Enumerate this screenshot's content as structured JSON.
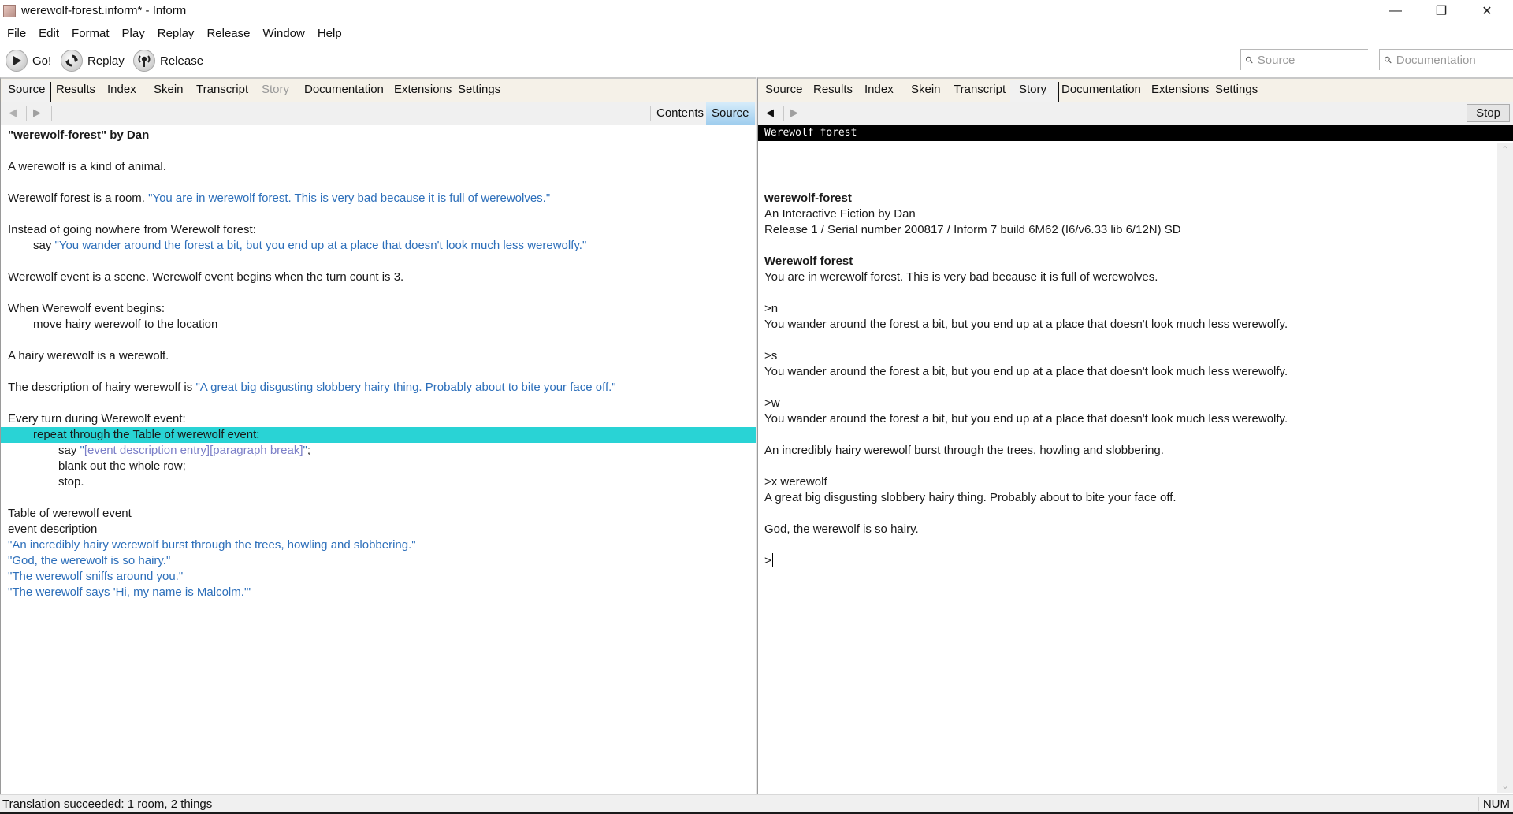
{
  "window": {
    "title": "werewolf-forest.inform* - Inform",
    "controls": {
      "minimize": "—",
      "maximize": "❐",
      "close": "✕"
    }
  },
  "menu": [
    "File",
    "Edit",
    "Format",
    "Play",
    "Replay",
    "Release",
    "Window",
    "Help"
  ],
  "toolbar": {
    "go": {
      "label": "Go!",
      "icon": "play-icon"
    },
    "replay": {
      "label": "Replay",
      "icon": "replay-icon"
    },
    "release": {
      "label": "Release",
      "icon": "release-icon"
    },
    "search_source_placeholder": "Source",
    "search_docs_placeholder": "Documentation"
  },
  "left_pane": {
    "tabs": [
      {
        "label": "Source",
        "selected": true,
        "dim": false
      },
      {
        "label": "Results",
        "dim": false
      },
      {
        "label": "Index",
        "dim": false
      },
      {
        "label": "Skein",
        "dim": false
      },
      {
        "label": "Transcript",
        "dim": false
      },
      {
        "label": "Story",
        "dim": true
      },
      {
        "label": "Documentation",
        "dim": false
      },
      {
        "label": "Extensions",
        "dim": false
      },
      {
        "label": "Settings",
        "dim": false
      }
    ],
    "nav": {
      "back": "◀",
      "forward": "▶",
      "contents_label": "Contents",
      "source_label": "Source"
    },
    "source_lines": [
      {
        "text": "\"werewolf-forest\" by Dan",
        "style": "bold"
      },
      {
        "text": ""
      },
      {
        "text": "A werewolf is a kind of animal."
      },
      {
        "text": ""
      },
      {
        "text": "Werewolf forest is a room. ",
        "quote": "\"You are in werewolf forest. This is very bad because it is full of werewolves.\""
      },
      {
        "text": ""
      },
      {
        "text": "Instead of going nowhere from Werewolf forest:"
      },
      {
        "text": "say ",
        "indent": 1,
        "quote": "\"You wander around the forest a bit, but you end up at a place that doesn't look much less werewolfy.\""
      },
      {
        "text": ""
      },
      {
        "text": "Werewolf event is a scene. Werewolf event begins when the turn count is 3."
      },
      {
        "text": ""
      },
      {
        "text": "When Werewolf event begins:"
      },
      {
        "text": "move hairy werewolf to the location",
        "indent": 1
      },
      {
        "text": ""
      },
      {
        "text": "A hairy werewolf is a werewolf."
      },
      {
        "text": ""
      },
      {
        "text": "The description of hairy werewolf is ",
        "quote": "\"A great big disgusting slobbery hairy thing. Probably about to bite your face off.\""
      },
      {
        "text": ""
      },
      {
        "text": "Every turn during Werewolf event:"
      },
      {
        "text": "repeat through the Table of werewolf event:",
        "indent": 1,
        "highlight": true
      },
      {
        "text": "say ",
        "indent": 2,
        "quote_open": "\"",
        "substitution": "[event description entry][paragraph break]",
        "quote_close": "\"",
        "tail": ";"
      },
      {
        "text": "blank out the whole row;",
        "indent": 2
      },
      {
        "text": "stop.",
        "indent": 2
      },
      {
        "text": ""
      },
      {
        "text": "Table of werewolf event"
      },
      {
        "text": "event description"
      },
      {
        "text": "",
        "quote": "\"An incredibly hairy werewolf burst through the trees, howling and slobbering.\""
      },
      {
        "text": "",
        "quote": "\"God, the werewolf is so hairy.\""
      },
      {
        "text": "",
        "quote": "\"The werewolf sniffs around you.\""
      },
      {
        "text": "",
        "quote": "\"The werewolf says 'Hi, my name is Malcolm.'\""
      }
    ]
  },
  "right_pane": {
    "tabs": [
      {
        "label": "Source",
        "dim": false
      },
      {
        "label": "Results",
        "dim": false
      },
      {
        "label": "Index",
        "dim": false
      },
      {
        "label": "Skein",
        "dim": false
      },
      {
        "label": "Transcript",
        "dim": false
      },
      {
        "label": "Story",
        "selected": true,
        "dim": false
      },
      {
        "label": "Documentation",
        "dim": false
      },
      {
        "label": "Extensions",
        "dim": false
      },
      {
        "label": "Settings",
        "dim": false
      }
    ],
    "nav": {
      "back": "◀",
      "forward": "▶",
      "stop_label": "Stop"
    },
    "status_line": "Werewolf forest",
    "story_lines": [
      {
        "text": "werewolf-forest",
        "style": "bold"
      },
      {
        "text": "An Interactive Fiction by Dan"
      },
      {
        "text": "Release 1 / Serial number 200817 / Inform 7 build 6M62 (I6/v6.33 lib 6/12N) SD"
      },
      {
        "text": ""
      },
      {
        "text": "Werewolf forest",
        "style": "bold"
      },
      {
        "text": "You are in werewolf forest. This is very bad because it is full of werewolves."
      },
      {
        "text": ""
      },
      {
        "text": ">n"
      },
      {
        "text": "You wander around the forest a bit, but you end up at a place that doesn't look much less werewolfy."
      },
      {
        "text": ""
      },
      {
        "text": ">s"
      },
      {
        "text": "You wander around the forest a bit, but you end up at a place that doesn't look much less werewolfy."
      },
      {
        "text": ""
      },
      {
        "text": ">w"
      },
      {
        "text": "You wander around the forest a bit, but you end up at a place that doesn't look much less werewolfy."
      },
      {
        "text": ""
      },
      {
        "text": "An incredibly hairy werewolf burst through the trees, howling and slobbering."
      },
      {
        "text": ""
      },
      {
        "text": ">x werewolf"
      },
      {
        "text": "A great big disgusting slobbery hairy thing. Probably about to bite your face off."
      },
      {
        "text": ""
      },
      {
        "text": "God, the werewolf is so hairy."
      },
      {
        "text": ""
      },
      {
        "text": ">",
        "style": "prompt"
      }
    ],
    "scroll": {
      "up": "⌃",
      "down": "⌄"
    }
  },
  "statusbar": {
    "message": "Translation succeeded: 1 room, 2 things",
    "indicator": "NUM"
  },
  "colors": {
    "highlight_line": "#29d3d5",
    "quoted_text": "#2d6fba",
    "substitution_text": "#7b7fc8",
    "tab_bar_bg": "#f5f1e8",
    "active_segment": "#9fcdee"
  }
}
